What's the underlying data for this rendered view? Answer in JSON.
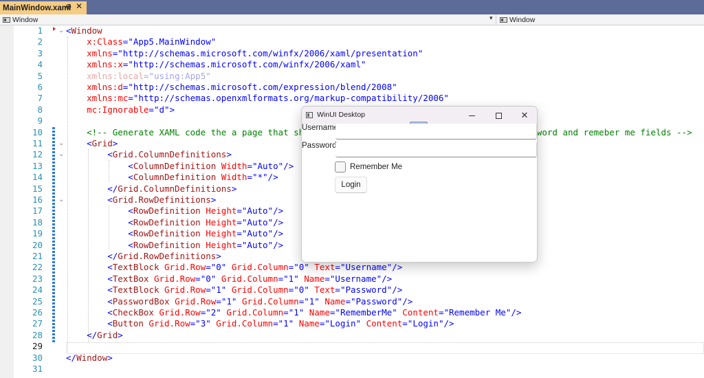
{
  "tab": {
    "title": "MainWindow.xaml",
    "pin_glyph": "⊕",
    "close_glyph": "✕"
  },
  "navbar": {
    "left_label": "Window",
    "right_label": "Window",
    "dropdown_glyph": "▾"
  },
  "editor": {
    "line_numbers": [
      "1",
      "2",
      "3",
      "4",
      "5",
      "6",
      "7",
      "8",
      "9",
      "10",
      "11",
      "12",
      "13",
      "14",
      "15",
      "16",
      "17",
      "18",
      "19",
      "20",
      "21",
      "22",
      "23",
      "24",
      "25",
      "26",
      "27",
      "28",
      "29",
      "30",
      "31"
    ],
    "current_line": "29",
    "code": [
      [
        [
          "br",
          "<"
        ],
        [
          "tag",
          "Window"
        ]
      ],
      [
        [
          "br",
          "    "
        ],
        [
          "attr",
          "x:Class"
        ],
        [
          "br",
          "="
        ],
        [
          "val",
          "\"App5.MainWindow\""
        ]
      ],
      [
        [
          "br",
          "    "
        ],
        [
          "attr",
          "xmlns"
        ],
        [
          "br",
          "="
        ],
        [
          "val",
          "\"http://schemas.microsoft.com/winfx/2006/xaml/presentation\""
        ]
      ],
      [
        [
          "br",
          "    "
        ],
        [
          "attr",
          "xmlns:x"
        ],
        [
          "br",
          "="
        ],
        [
          "val",
          "\"http://schemas.microsoft.com/winfx/2006/xaml\""
        ]
      ],
      [
        [
          "br",
          "    "
        ],
        [
          "dima",
          "xmlns:local"
        ],
        [
          "dimv",
          "=\"using:App5\""
        ]
      ],
      [
        [
          "br",
          "    "
        ],
        [
          "attr",
          "xmlns:d"
        ],
        [
          "br",
          "="
        ],
        [
          "val",
          "\"http://schemas.microsoft.com/expression/blend/2008\""
        ]
      ],
      [
        [
          "br",
          "    "
        ],
        [
          "attr",
          "xmlns:mc"
        ],
        [
          "br",
          "="
        ],
        [
          "val",
          "\"http://schemas.openxmlformats.org/markup-compatibility/2006\""
        ]
      ],
      [
        [
          "br",
          "    "
        ],
        [
          "attr",
          "mc:Ignorable"
        ],
        [
          "br",
          "="
        ],
        [
          "val",
          "\"d\""
        ],
        [
          "br",
          ">"
        ]
      ],
      [],
      [
        [
          "br",
          "    "
        ],
        [
          "cmt",
          "<!-- Generate XAML code the a page that sho"
        ],
        [
          "br",
          "                                         "
        ],
        [
          "cmt",
          "assword and remeber me fields -->"
        ]
      ],
      [
        [
          "br",
          "    <"
        ],
        [
          "tag",
          "Grid"
        ],
        [
          "br",
          ">"
        ]
      ],
      [
        [
          "br",
          "        <"
        ],
        [
          "tag",
          "Grid.ColumnDefinitions"
        ],
        [
          "br",
          ">"
        ]
      ],
      [
        [
          "br",
          "            <"
        ],
        [
          "tag",
          "ColumnDefinition"
        ],
        [
          "br",
          " "
        ],
        [
          "attr",
          "Width"
        ],
        [
          "br",
          "="
        ],
        [
          "val",
          "\"Auto\""
        ],
        [
          "br",
          "/>"
        ]
      ],
      [
        [
          "br",
          "            <"
        ],
        [
          "tag",
          "ColumnDefinition"
        ],
        [
          "br",
          " "
        ],
        [
          "attr",
          "Width"
        ],
        [
          "br",
          "="
        ],
        [
          "val",
          "\"*\""
        ],
        [
          "br",
          "/>"
        ]
      ],
      [
        [
          "br",
          "        </"
        ],
        [
          "tag",
          "Grid.ColumnDefinitions"
        ],
        [
          "br",
          ">"
        ]
      ],
      [
        [
          "br",
          "        <"
        ],
        [
          "tag",
          "Grid.RowDefinitions"
        ],
        [
          "br",
          ">"
        ]
      ],
      [
        [
          "br",
          "            <"
        ],
        [
          "tag",
          "RowDefinition"
        ],
        [
          "br",
          " "
        ],
        [
          "attr",
          "Height"
        ],
        [
          "br",
          "="
        ],
        [
          "val",
          "\"Auto\""
        ],
        [
          "br",
          "/>"
        ]
      ],
      [
        [
          "br",
          "            <"
        ],
        [
          "tag",
          "RowDefinition"
        ],
        [
          "br",
          " "
        ],
        [
          "attr",
          "Height"
        ],
        [
          "br",
          "="
        ],
        [
          "val",
          "\"Auto\""
        ],
        [
          "br",
          "/>"
        ]
      ],
      [
        [
          "br",
          "            <"
        ],
        [
          "tag",
          "RowDefinition"
        ],
        [
          "br",
          " "
        ],
        [
          "attr",
          "Height"
        ],
        [
          "br",
          "="
        ],
        [
          "val",
          "\"Auto\""
        ],
        [
          "br",
          "/>"
        ]
      ],
      [
        [
          "br",
          "            <"
        ],
        [
          "tag",
          "RowDefinition"
        ],
        [
          "br",
          " "
        ],
        [
          "attr",
          "Height"
        ],
        [
          "br",
          "="
        ],
        [
          "val",
          "\"Auto\""
        ],
        [
          "br",
          "/>"
        ]
      ],
      [
        [
          "br",
          "        </"
        ],
        [
          "tag",
          "Grid.RowDefinitions"
        ],
        [
          "br",
          ">"
        ]
      ],
      [
        [
          "br",
          "        <"
        ],
        [
          "tag",
          "TextBlock"
        ],
        [
          "br",
          " "
        ],
        [
          "attr",
          "Grid.Row"
        ],
        [
          "br",
          "="
        ],
        [
          "val",
          "\"0\""
        ],
        [
          "br",
          " "
        ],
        [
          "attr",
          "Grid.Column"
        ],
        [
          "br",
          "="
        ],
        [
          "val",
          "\"0\""
        ],
        [
          "br",
          " "
        ],
        [
          "attr",
          "Text"
        ],
        [
          "br",
          "="
        ],
        [
          "val",
          "\"Username\""
        ],
        [
          "br",
          "/>"
        ]
      ],
      [
        [
          "br",
          "        <"
        ],
        [
          "tag",
          "TextBox"
        ],
        [
          "br",
          " "
        ],
        [
          "attr",
          "Grid.Row"
        ],
        [
          "br",
          "="
        ],
        [
          "val",
          "\"0\""
        ],
        [
          "br",
          " "
        ],
        [
          "attr",
          "Grid.Column"
        ],
        [
          "br",
          "="
        ],
        [
          "val",
          "\"1\""
        ],
        [
          "br",
          " "
        ],
        [
          "attr",
          "Name"
        ],
        [
          "br",
          "="
        ],
        [
          "val",
          "\"Username\""
        ],
        [
          "br",
          "/>"
        ]
      ],
      [
        [
          "br",
          "        <"
        ],
        [
          "tag",
          "TextBlock"
        ],
        [
          "br",
          " "
        ],
        [
          "attr",
          "Grid.Row"
        ],
        [
          "br",
          "="
        ],
        [
          "val",
          "\"1\""
        ],
        [
          "br",
          " "
        ],
        [
          "attr",
          "Grid.Column"
        ],
        [
          "br",
          "="
        ],
        [
          "val",
          "\"0\""
        ],
        [
          "br",
          " "
        ],
        [
          "attr",
          "Text"
        ],
        [
          "br",
          "="
        ],
        [
          "val",
          "\"Password\""
        ],
        [
          "br",
          "/>"
        ]
      ],
      [
        [
          "br",
          "        <"
        ],
        [
          "tag",
          "PasswordBox"
        ],
        [
          "br",
          " "
        ],
        [
          "attr",
          "Grid.Row"
        ],
        [
          "br",
          "="
        ],
        [
          "val",
          "\"1\""
        ],
        [
          "br",
          " "
        ],
        [
          "attr",
          "Grid.Column"
        ],
        [
          "br",
          "="
        ],
        [
          "val",
          "\"1\""
        ],
        [
          "br",
          " "
        ],
        [
          "attr",
          "Name"
        ],
        [
          "br",
          "="
        ],
        [
          "val",
          "\"Password\""
        ],
        [
          "br",
          "/>"
        ]
      ],
      [
        [
          "br",
          "        <"
        ],
        [
          "tag",
          "CheckBox"
        ],
        [
          "br",
          " "
        ],
        [
          "attr",
          "Grid.Row"
        ],
        [
          "br",
          "="
        ],
        [
          "val",
          "\"2\""
        ],
        [
          "br",
          " "
        ],
        [
          "attr",
          "Grid.Column"
        ],
        [
          "br",
          "="
        ],
        [
          "val",
          "\"1\""
        ],
        [
          "br",
          " "
        ],
        [
          "attr",
          "Name"
        ],
        [
          "br",
          "="
        ],
        [
          "val",
          "\"RememberMe\""
        ],
        [
          "br",
          " "
        ],
        [
          "attr",
          "Content"
        ],
        [
          "br",
          "="
        ],
        [
          "val",
          "\"Remember Me\""
        ],
        [
          "br",
          "/>"
        ]
      ],
      [
        [
          "br",
          "        <"
        ],
        [
          "tag",
          "Button"
        ],
        [
          "br",
          " "
        ],
        [
          "attr",
          "Grid.Row"
        ],
        [
          "br",
          "="
        ],
        [
          "val",
          "\"3\""
        ],
        [
          "br",
          " "
        ],
        [
          "attr",
          "Grid.Column"
        ],
        [
          "br",
          "="
        ],
        [
          "val",
          "\"1\""
        ],
        [
          "br",
          " "
        ],
        [
          "attr",
          "Name"
        ],
        [
          "br",
          "="
        ],
        [
          "val",
          "\"Login\""
        ],
        [
          "br",
          " "
        ],
        [
          "attr",
          "Content"
        ],
        [
          "br",
          "="
        ],
        [
          "val",
          "\"Login\""
        ],
        [
          "br",
          "/>"
        ]
      ],
      [
        [
          "br",
          "    </"
        ],
        [
          "tag",
          "Grid"
        ],
        [
          "br",
          ">"
        ]
      ],
      [],
      [
        [
          "br",
          "</"
        ],
        [
          "tag",
          "Window"
        ],
        [
          "br",
          ">"
        ]
      ],
      []
    ],
    "colors": {
      "tag": "#a31515",
      "attr": "#ff0000",
      "value": "#0000ff",
      "comment": "#008000",
      "line_number": "#2b91af"
    }
  },
  "app_window": {
    "title": "WinUI Desktop",
    "minimize_label": "—",
    "maximize_label": "☐",
    "close_label": "✕",
    "username_label": "Username",
    "username_value": "",
    "password_label": "Password",
    "password_value": "",
    "remember_label": "Remember Me",
    "remember_checked": false,
    "login_label": "Login"
  }
}
